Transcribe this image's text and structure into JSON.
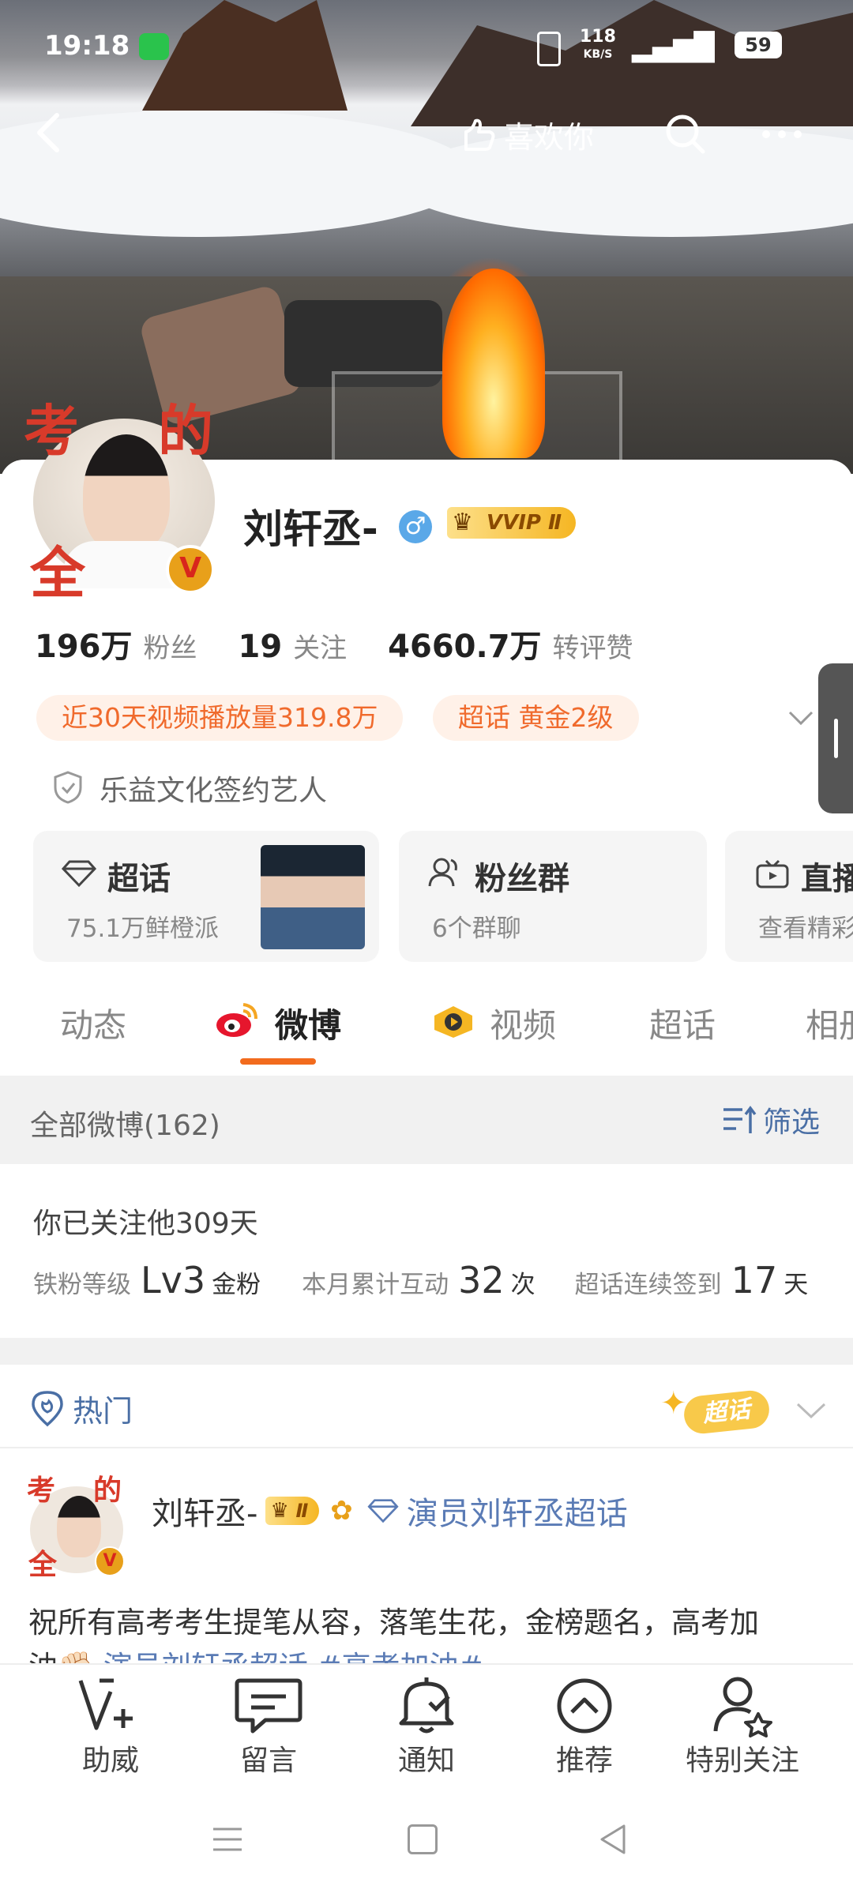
{
  "status_bar": {
    "time": "19:18",
    "net_speed": "118",
    "net_unit": "KB/S",
    "battery": "59"
  },
  "top_bar": {
    "like_label": "喜欢你"
  },
  "profile": {
    "username": "刘轩丞-",
    "vip_badge": "VVIP Ⅱ",
    "avatar_text": [
      "考",
      "的",
      "全"
    ],
    "stats": [
      {
        "value": "196万",
        "label": "粉丝"
      },
      {
        "value": "19",
        "label": "关注"
      },
      {
        "value": "4660.7万",
        "label": "转评赞"
      }
    ],
    "tags": [
      "近30天视频播放量319.8万",
      "超话 黄金2级"
    ],
    "verification": "乐益文化签约艺人"
  },
  "tiles": [
    {
      "title": "超话",
      "sub": "75.1万鲜橙派"
    },
    {
      "title": "粉丝群",
      "sub": "6个群聊"
    },
    {
      "title": "直播",
      "sub": "查看精彩"
    }
  ],
  "tabs": [
    "动态",
    "微博",
    "视频",
    "超话",
    "相册"
  ],
  "filter_bar": {
    "title": "全部微博(162)",
    "filter_label": "筛选"
  },
  "fan_info": {
    "follow_days": "你已关注他309天",
    "level_label": "铁粉等级",
    "level_value": "Lv3",
    "level_suffix": "金粉",
    "interact_label": "本月累计互动",
    "interact_value": "32",
    "interact_unit": "次",
    "checkin_label": "超话连续签到",
    "checkin_value": "17",
    "checkin_unit": "天"
  },
  "hot_section": {
    "label": "热门",
    "supertopic_badge": "超话"
  },
  "post": {
    "author": "刘轩丞-",
    "vip_small": "Ⅱ",
    "supertopic_link": "演员刘轩丞超话",
    "text_line1": "祝所有高考考生提笔从容，落笔生花，金榜题名，高考加",
    "text_line2_prefix": "油✊🏻 ",
    "text_line2_link": "演员刘轩丞超话 #高考加油#"
  },
  "bottom_nav": [
    "助威",
    "留言",
    "通知",
    "推荐",
    "特别关注"
  ],
  "colors": {
    "accent": "#f06a2c",
    "link": "#5a7bb5",
    "vip_gold": "#f5b623",
    "tab_underline": "#f26b1d"
  }
}
